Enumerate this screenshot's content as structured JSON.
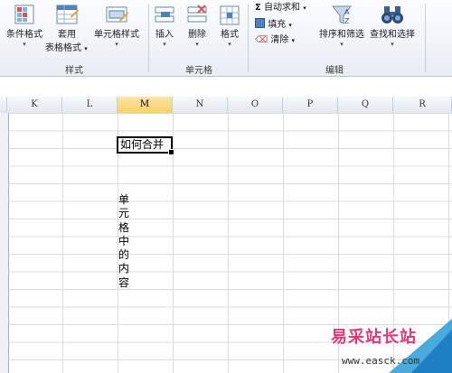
{
  "ribbon": {
    "styles": {
      "conditional_format": "条件格式",
      "table_format_1": "套用",
      "table_format_2": "表格格式",
      "cell_styles": "单元格样式",
      "group": "样式"
    },
    "cells": {
      "insert": "插入",
      "delete": "删除",
      "format": "格式",
      "group": "单元格"
    },
    "editing": {
      "autosum": "自动求和",
      "fill": "填充",
      "clear": "清除",
      "sort_filter": "排序和筛选",
      "find_select": "查找和选择",
      "group": "编辑"
    }
  },
  "columns": [
    "K",
    "L",
    "M",
    "N",
    "O",
    "P",
    "Q",
    "R"
  ],
  "selected_column": "M",
  "cells": {
    "m_active": "如何合并",
    "vertical": [
      "单",
      "元",
      "格",
      "中",
      "的",
      "内",
      "容"
    ]
  },
  "watermark": {
    "title": "易采站长站",
    "url": "www.easck.com"
  }
}
